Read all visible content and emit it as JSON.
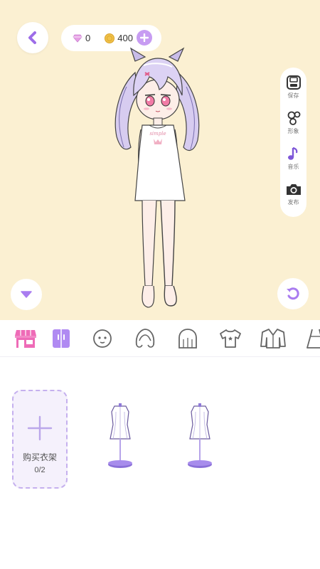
{
  "header": {
    "gems": "0",
    "coins": "400"
  },
  "side_menu": [
    {
      "label": "保存",
      "icon": "save-icon"
    },
    {
      "label": "形象",
      "icon": "avatar-icon"
    },
    {
      "label": "音乐",
      "icon": "music-icon"
    },
    {
      "label": "发布",
      "icon": "camera-icon"
    }
  ],
  "tabs": [
    {
      "icon": "shop-icon",
      "active": true
    },
    {
      "icon": "wardrobe-icon"
    },
    {
      "icon": "face-icon"
    },
    {
      "icon": "front-hair-icon"
    },
    {
      "icon": "back-hair-icon"
    },
    {
      "icon": "tshirt-icon"
    },
    {
      "icon": "jacket-icon"
    },
    {
      "icon": "dress-icon"
    }
  ],
  "panel": {
    "buy_rack_label": "购买衣架",
    "rack_count": "0/2"
  },
  "character": {
    "shirt_text": "simple"
  },
  "colors": {
    "accent": "#a97cf0",
    "background": "#fbf0d2",
    "shop_pink": "#ee6bb7"
  }
}
